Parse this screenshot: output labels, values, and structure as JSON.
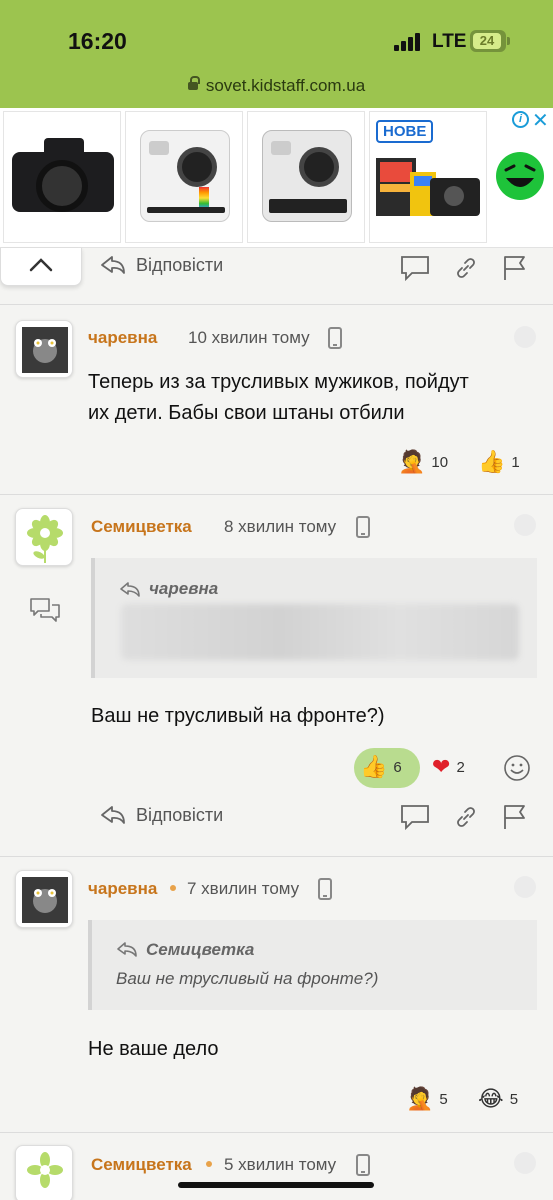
{
  "status_bar": {
    "time": "16:20",
    "network": "LTE",
    "battery": "24"
  },
  "browser": {
    "url": "sovet.kidstaff.com.ua"
  },
  "ad": {
    "badge": "НОВЕ",
    "info_icon": "i",
    "close_icon": "✕"
  },
  "reply_label": "Відповісти",
  "comments": [
    {
      "author": "чаревна",
      "time_ago": "10 хвилин тому",
      "text_line1": "Теперь из за трусливых мужиков, пойдут",
      "text_line2": "их дети. Бабы свои штаны отбили",
      "reactions": [
        {
          "emoji": "🤦",
          "count": "10"
        },
        {
          "emoji": "👍",
          "count": "1"
        }
      ]
    },
    {
      "author": "Семицветка",
      "time_ago": "8 хвилин тому",
      "quote_author": "чаревна",
      "text": "Ваш не трусливый на фронте?)",
      "reactions": [
        {
          "emoji": "👍",
          "count": "6"
        },
        {
          "emoji": "❤",
          "count": "2"
        }
      ]
    },
    {
      "author": "чаревна",
      "time_ago": "7 хвилин тому",
      "quote_author": "Семицветка",
      "quote_text": "Ваш не трусливый на фронте?)",
      "text": "Не ваше дело",
      "reactions": [
        {
          "emoji": "🤦",
          "count": "5"
        },
        {
          "emoji": "😂",
          "count": "5"
        }
      ]
    },
    {
      "author": "Семицветка",
      "time_ago": "5 хвилин тому"
    }
  ],
  "colors": {
    "status_bar": "#9cc44f",
    "author": "#c7751c",
    "like_pill": "#b9dc8f"
  }
}
